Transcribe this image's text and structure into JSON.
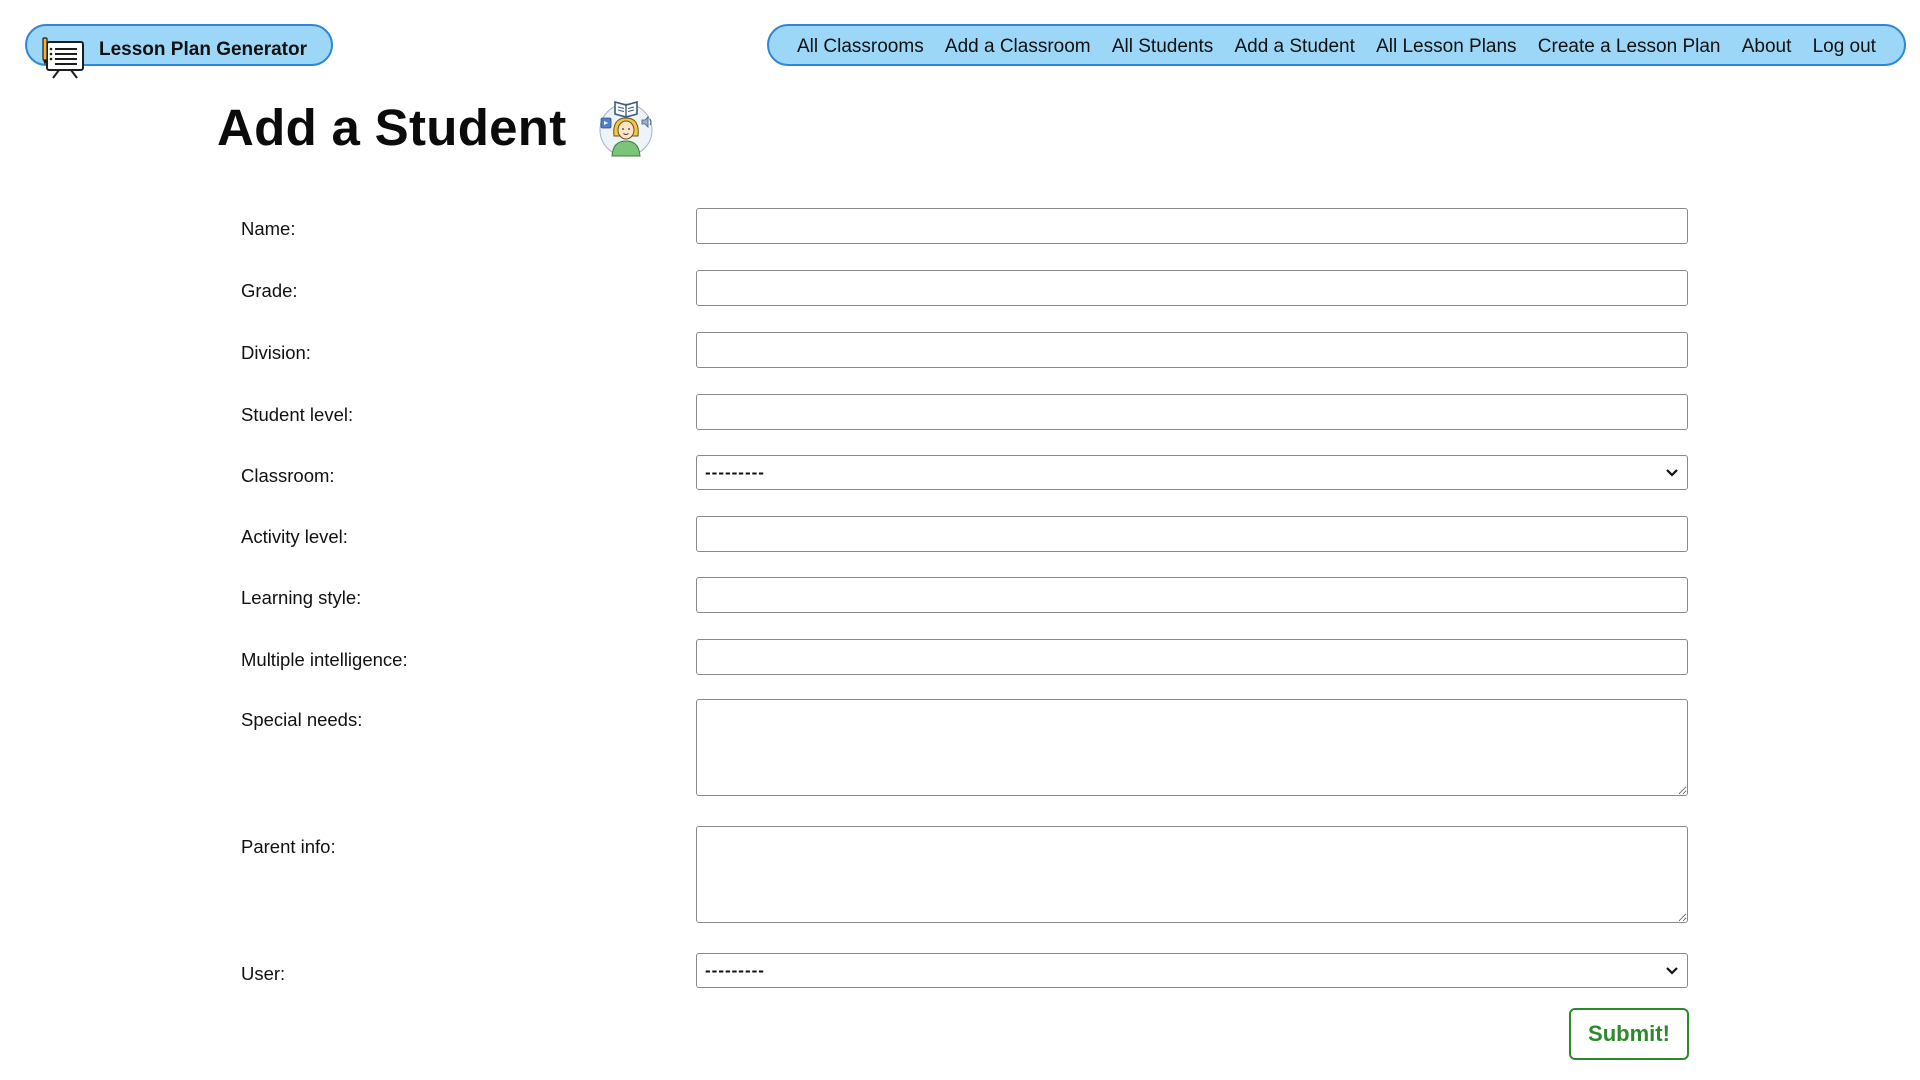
{
  "header": {
    "brand_text": "Lesson Plan Generator",
    "nav": [
      "All Classrooms",
      "Add a Classroom",
      "All Students",
      "Add a Student",
      "All Lesson Plans",
      "Create a Lesson Plan",
      "About",
      "Log out"
    ]
  },
  "page": {
    "title": "Add a Student"
  },
  "form": {
    "name_label": "Name:",
    "name_value": "",
    "grade_label": "Grade:",
    "grade_value": "",
    "division_label": "Division:",
    "division_value": "",
    "student_level_label": "Student level:",
    "student_level_value": "",
    "classroom_label": "Classroom:",
    "classroom_selected": "---------",
    "activity_level_label": "Activity level:",
    "activity_level_value": "",
    "learning_style_label": "Learning style:",
    "learning_style_value": "",
    "multiple_intelligence_label": "Multiple intelligence:",
    "multiple_intelligence_value": "",
    "special_needs_label": "Special needs:",
    "special_needs_value": "",
    "parent_info_label": "Parent info:",
    "parent_info_value": "",
    "user_label": "User:",
    "user_selected": "---------",
    "submit_label": "Submit!"
  },
  "colors": {
    "nav_background": "#9dd7f8",
    "nav_border": "#2f86d6",
    "submit_green": "#2c8a2c"
  },
  "icons": {
    "brand": "lesson-board-icon",
    "title": "student-reading-icon",
    "select": "chevron-down-icon"
  }
}
